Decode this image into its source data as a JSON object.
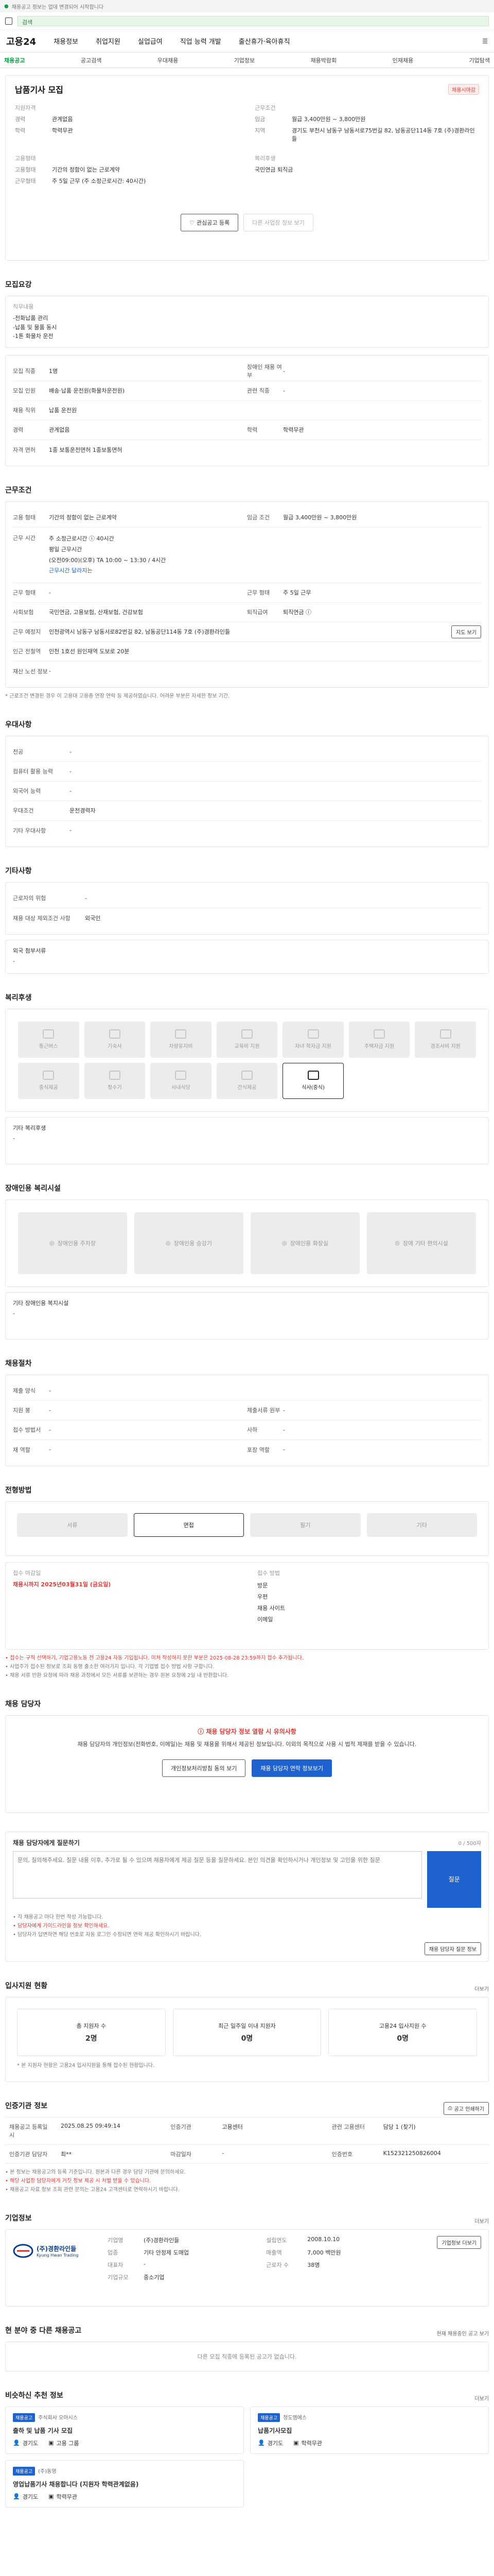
{
  "top": {
    "notice": "채용공고 정보는 업데 변경되어 시작합니다",
    "search": "검색"
  },
  "header": {
    "logo": "고용24",
    "nav": [
      "채용정보",
      "취업지원",
      "실업급여",
      "직업 능력 개발",
      "출산휴가·육아휴직"
    ]
  },
  "subnav": [
    "채용공고",
    "공고검색",
    "우대채용",
    "기업정보",
    "채용박람회",
    "인재채용",
    "기업탐색"
  ],
  "job": {
    "title": "납품기사 모집",
    "badge": "채용시마감",
    "company_label": "지원자격",
    "experience_k": "경력",
    "experience_v": "관계없음",
    "education_k": "학력",
    "education_v": "학력무관",
    "work_label": "근무조건",
    "salary_k": "임금",
    "salary_v": "월급 3,400만원 ~ 3,800만원",
    "location_k": "지역",
    "location_v": "경기도 부천시 남동구 남동서로75번길 82, 남동공단114동 7호 (주)경환라인들",
    "worktype_label": "고용형태",
    "employ_k": "고용형태",
    "employ_v": "기간의 정함이 없는 근로계약",
    "hours_k": "근무형태",
    "hours_v": "주 5일 근무 (주 소정근로시간: 40시간)",
    "welfare_label": "복리후생",
    "welfare_v": "국민연금 퇴직금",
    "apply_button": "관심공고 등록",
    "share_button": "다른 사업장 정보 보기"
  },
  "recruit": {
    "title": "모집요강",
    "duty_k": "직무내용",
    "duty_lines": [
      "-전화납품 관리",
      "-납품 및 물품 동시",
      "-1톤 화물차 운전"
    ],
    "rows": [
      {
        "k": "모집 직종",
        "v": "1명",
        "k2": "장애인 채용 여부",
        "v2": "-"
      },
      {
        "k": "모집 인원",
        "v": "배송·납품 운전원(화물차운전원)",
        "k2": "관련 직종",
        "v2": "-"
      },
      {
        "k": "채용 직위",
        "v": "납품 운전원",
        "k2": "",
        "v2": ""
      },
      {
        "k": "경력",
        "v": "관계없음",
        "k2": "학력",
        "v2": "학력무관"
      },
      {
        "k": "자격 면허",
        "v": "1종 보통운전면허 1종보통면허",
        "k2": "",
        "v2": ""
      }
    ]
  },
  "conditions": {
    "title": "근무조건",
    "employ_k": "고용 형태",
    "employ_v": "기간의 정함이 없는 근로계약",
    "wage_k": "임금 조건",
    "wage_v": "월급 3,400만원 ~ 3,800만원",
    "time_k": "근무 시간",
    "time_v1": "주 소정근로시간 ⓘ 40시간",
    "time_v2": "평일 근무시간",
    "time_v3": "(오전09:00)(오후) TA 10:00 ~ 13:30 / 4시간",
    "time_v4": "근무시간 달라지는",
    "type_k": "근무 형태",
    "type_v": "-",
    "type_k2": "근무 형태",
    "type_v2": "주 5일 근무",
    "insure_k": "사회보험",
    "insure_v": "국민연금, 고용보험, 산재보험, 건강보험",
    "insure_k2": "퇴직급여",
    "insure_v2": "퇴직연금 ⓘ",
    "place_k": "근무 예정지",
    "place_v": "인천광역시 남동구 남동서로82번길 82, 남동공단114동 7호 (주)경환라인들",
    "place_btn": "지도 보기",
    "near_k": "인근 전철역",
    "near_v": "인천 1호선 원인재역 도보로 20분",
    "extra_k": "재산 노선 정보",
    "extra_v": "-",
    "note": "* 근로조건 변경된 경우 이 고용대 고용종 연장 연락 등 제공하였습니다. 어려운 부분은 자세한 정보 기간."
  },
  "pref": {
    "title": "우대사항",
    "rows": [
      {
        "k": "전공",
        "v": "-"
      },
      {
        "k": "컴퓨터 활용 능력",
        "v": "-"
      },
      {
        "k": "외국어 능력",
        "v": "-"
      },
      {
        "k": "우대조건",
        "v": "운전경력자"
      },
      {
        "k": "기타 우대사항",
        "v": "-"
      }
    ]
  },
  "etc": {
    "title": "기타사항",
    "rows": [
      {
        "k": "근로자의 위험",
        "v": "-"
      },
      {
        "k": "채용 대상 제외조건 사항",
        "v": "외국인"
      }
    ],
    "attach": "외국 첨부서류",
    "attach_v": "-"
  },
  "benefits": {
    "title": "복리후생",
    "items": [
      "통근버스",
      "기숙사",
      "차량유지비",
      "교육비 지원",
      "자녀 학자금 지원",
      "주택자금 지원",
      "경조사비 지원",
      "중식제공",
      "정수기",
      "사내식당",
      "간식제공",
      "식사(중식)"
    ],
    "active_index": 11,
    "other_k": "기타 복리후생",
    "other_v": "-"
  },
  "facilities": {
    "title": "장애인용 복리시설",
    "items": [
      "장애인용 주차장",
      "장애인용 승강기",
      "장애인용 화장실",
      "장애 기타 편의시설"
    ],
    "other_k": "기타 장애인용 복지시설",
    "other_v": "-"
  },
  "process": {
    "title": "채용절차",
    "rows": [
      {
        "k": "제출 양식",
        "v": "-",
        "k2": "",
        "v2": ""
      },
      {
        "k": "지원 봉",
        "v": "-",
        "k2": "제출서류 원부",
        "v2": "-"
      },
      {
        "k": "접수 방법서",
        "v": "-",
        "k2": "사하",
        "v2": "-"
      },
      {
        "k": "채 역할",
        "v": "-",
        "k2": "포장 역할",
        "v2": "-"
      }
    ]
  },
  "method": {
    "title": "전형방법",
    "items": [
      "서류",
      "면접",
      "필기",
      "기타"
    ],
    "active_index": 1,
    "deadline_k": "접수 마감일",
    "deadline_v": "채용시까지 2025년03월31일 (금요일)",
    "way_k": "접수 방법",
    "way_items": [
      "방문",
      "우편",
      "채용 사이트",
      "이메일"
    ],
    "notes": [
      "• 접수는 구직 선택하기, 기업고용노동 전 고용24 자동 기입됩니다. 미처 작성하지 못한 부분은 2025-08-28 23:59까지 접수 추가됩니다.",
      "• 사업주가 접수된 정보로 조회 동행 출소한 여러가지 입니다. 각 기업별 접수 방법 사항 구합니다.",
      "• 채용 서류 반환 요청에 따라 채용 과정에서 모든 서류를 보관하는 경우 원본 요청에 2일 내 반환합니다."
    ]
  },
  "contact": {
    "title": "채용 담당자",
    "alert": "채용 담당자 정보 열람 시 유의사항",
    "alert_text": "채용 담당자의 개인정보(전화번호, 이메일)는 채용 및 채용을 위해서 제공된 정보입니다. 이외의 목적으로 사용 시 법적 제재를 받을 수 있습니다.",
    "btn_contact": "개인정보처리방침 동의 보기",
    "btn_view": "채용 담당자 연락 정보보기"
  },
  "qna": {
    "title": "채용 담당자에게 질문하기",
    "placeholder": "문의, 질의해주세요. 질문 내용 이후, 추가로 될 수 있으며 채용자에게 제공 질문 등을 질문하세요. 본인 의견을 확인하시거나 개인정보 및 고민을 위한 질문",
    "count": "0 / 500자",
    "submit": "질문",
    "notes": [
      "• 각 채용공고 마다 한번 작성 가능합니다.",
      "• 담당자에게 가이드라인을 정보 확인하세요.",
      "• 담당자가 답변하면 해당 번호로 자동 로그인 수정되면 연락 제공 확인하시기 바랍니다."
    ],
    "note_btn": "채용 담당자 질문 정보"
  },
  "stats": {
    "title": "입사지원 현황",
    "items": [
      {
        "label": "총 지원자 수",
        "n": "2명"
      },
      {
        "label": "최근 일주일 이내 지원자",
        "n": "0명"
      },
      {
        "label": "고용24 입사지원 수",
        "n": "0명"
      }
    ],
    "note": "* 본 지원자 현황은 고용24 입사지원을 통해 접수된 현황입니다.",
    "more": "더보기"
  },
  "reg": {
    "title": "인증기관 정보",
    "print": "공고 인쇄하기",
    "rows": [
      {
        "k": "채용공고 등록일시",
        "v": "2025.08.25 09:49:14",
        "k2": "인증기관",
        "v2": "고용센터",
        "k3": "관련 고용센터",
        "v3": "담당 1 (찾기)"
      },
      {
        "k": "인증기관 담당자",
        "v": "최**",
        "k2": "마감일자",
        "v2": "-",
        "k3": "인증번호",
        "v3": "K152321250826004"
      }
    ],
    "notes": [
      "• 본 정보는 채용공고의 등록 기준입니다. 원본과 다른 경우 담당 기관에 문의하세요.",
      "• 해당 사업장 담당자에게 거짓 정보 제공 시 처벌 받을 수 있습니다.",
      "• 채용공고 자료 정보 조회 관련 문의는 고용24 고객센터로 연락하시기 바랍니다."
    ]
  },
  "company": {
    "title": "기업정보",
    "more": "더보기",
    "logo_text": "(주)경환라인들",
    "logo_sub": "Kyung Hwan Trading",
    "rows": [
      {
        "k": "기업명",
        "v": "(주)경환라인들",
        "k2": "설립연도",
        "v2": "2008.10.10",
        "k3": "",
        "v3": ""
      },
      {
        "k": "업종",
        "v": "기타 안정제 도매업",
        "k2": "매출액",
        "v2": "7,000 백만원",
        "k3": "",
        "v3": ""
      },
      {
        "k": "대표자",
        "v": "-",
        "k2": "근로자 수",
        "v2": "38명",
        "k3": "",
        "v3": ""
      },
      {
        "k": "기업규모",
        "v": "중소기업",
        "k2": "",
        "v2": "",
        "k3": "",
        "v3": ""
      }
    ],
    "btn": "기업정보 더보기"
  },
  "same": {
    "title": "현 분야 중 다른 채용공고",
    "empty": "다른 모집 직종에 등록된 공고가 없습니다.",
    "link": "현재 채용중인 공고 보기"
  },
  "related": {
    "title": "비슷하신 추천 정보",
    "more": "더보기",
    "cards": [
      {
        "tag": "채용공고",
        "company": "주식회사 오아시스",
        "job": "출하 및 납품 기사 모집",
        "loc": "경기도",
        "type": "고용 그룹"
      },
      {
        "tag": "채용공고",
        "company": "청도엠에스",
        "job": "납품기사모집",
        "loc": "경기도",
        "type": "학력무관"
      },
      {
        "tag": "채용공고",
        "company": "(주)동영",
        "job": "영업납품기사 채용합니다 (지원자 학력관계없음)",
        "loc": "경기도",
        "type": "학력무관"
      }
    ]
  }
}
